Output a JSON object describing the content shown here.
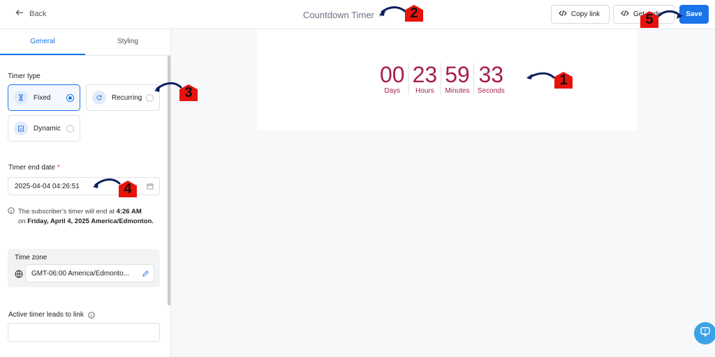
{
  "header": {
    "back_label": "Back",
    "title": "Countdown Timer",
    "copy_link_label": "Copy link",
    "get_code_label": "Get code",
    "save_label": "Save"
  },
  "sidebar": {
    "tabs": [
      {
        "label": "General"
      },
      {
        "label": "Styling"
      }
    ],
    "timer_type_label": "Timer type",
    "timer_types": [
      {
        "label": "Fixed",
        "selected": true
      },
      {
        "label": "Recurring",
        "selected": false
      },
      {
        "label": "Dynamic",
        "selected": false
      }
    ],
    "end_date_label": "Timer end date",
    "end_date_value": "2025-04-04 04:26:51",
    "info_prefix": "The subscriber's timer will end at",
    "info_time": "4:26 AM",
    "info_on": "on",
    "info_date": "Friday, April 4, 2025 America/Edmonton.",
    "timezone_label": "Time zone",
    "timezone_value": "GMT-06:00 America/Edmonto...",
    "link_label": "Active timer leads to link"
  },
  "timer": {
    "units": [
      {
        "value": "00",
        "label": "Days"
      },
      {
        "value": "23",
        "label": "Hours"
      },
      {
        "value": "59",
        "label": "Minutes"
      },
      {
        "value": "33",
        "label": "Seconds"
      }
    ],
    "color": "#a4204b"
  },
  "annotations": [
    "1",
    "2",
    "3",
    "4",
    "5"
  ],
  "colors": {
    "accent": "#1a73e8",
    "annotation": "#e8120c"
  }
}
